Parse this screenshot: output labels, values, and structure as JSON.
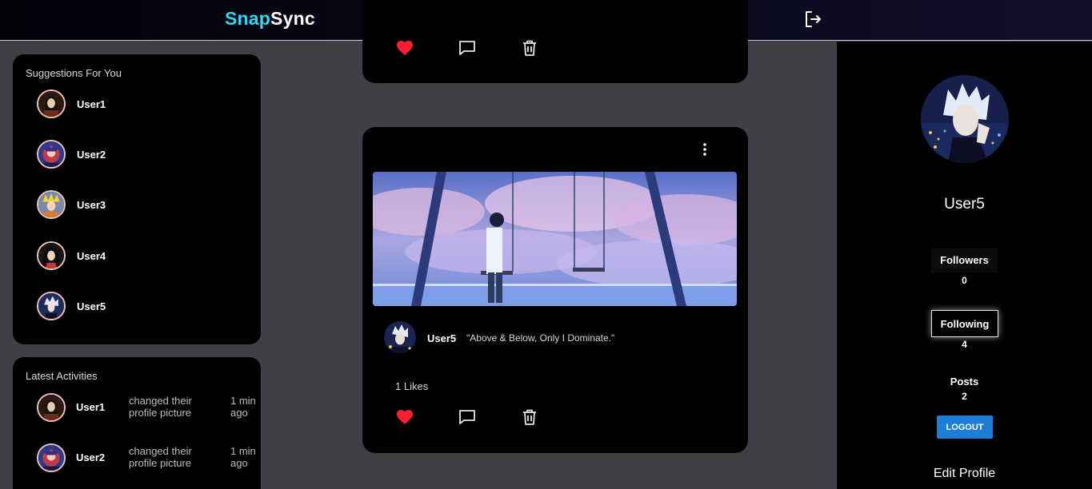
{
  "brand": {
    "part1": "Snap",
    "part2": "Sync"
  },
  "nav": {
    "icons": [
      "home-icon",
      "plus-icon",
      "search-icon",
      "account-circle-icon",
      "logout-icon"
    ],
    "active_color": "#33d6f2"
  },
  "suggestions": {
    "title": "Suggestions For You",
    "users": [
      {
        "name": "User1"
      },
      {
        "name": "User2"
      },
      {
        "name": "User3"
      },
      {
        "name": "User4"
      },
      {
        "name": "User5"
      }
    ]
  },
  "activities": {
    "title": "Latest Activities",
    "items": [
      {
        "user": "User1",
        "text": "changed their profile picture",
        "time": "1 min ago"
      },
      {
        "user": "User2",
        "text": "changed their profile picture",
        "time": "1 min ago"
      }
    ]
  },
  "post": {
    "author": "User5",
    "caption": "\"Above & Below, Only I Dominate.\"",
    "likes": "1 Likes",
    "liked": true
  },
  "profile": {
    "name": "User5",
    "followers_label": "Followers",
    "followers_count": "0",
    "following_label": "Following",
    "following_count": "4",
    "posts_label": "Posts",
    "posts_count": "2",
    "logout_label": "LOGOUT",
    "edit_label": "Edit Profile"
  },
  "colors": {
    "accent": "#33d6f2",
    "like_red": "#ff1f2f",
    "logout_blue": "#1c7ed6",
    "background": "#3f4046"
  }
}
